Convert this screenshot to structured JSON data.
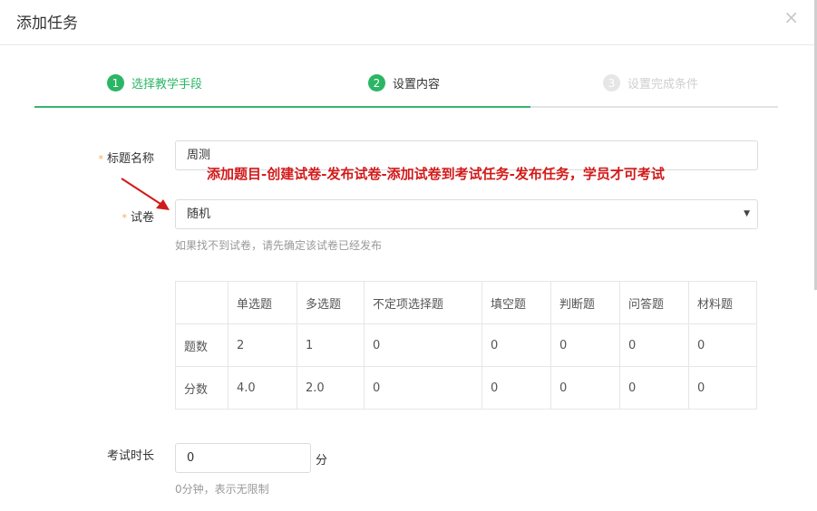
{
  "modal": {
    "title": "添加任务",
    "close": "×"
  },
  "steps": [
    {
      "num": "1",
      "label": "选择教学手段"
    },
    {
      "num": "2",
      "label": "设置内容"
    },
    {
      "num": "3",
      "label": "设置完成条件"
    }
  ],
  "form": {
    "title_label": "标题名称",
    "title_value": "周测",
    "paper_label": "试卷",
    "paper_value": "随机",
    "paper_hint": "如果找不到试卷，请先确定该试卷已经发布",
    "duration_label": "考试时长",
    "duration_value": "0",
    "duration_unit": "分",
    "duration_hint": "0分钟，表示无限制",
    "required_mark": "*"
  },
  "annotation": {
    "text": "添加题目-创建试卷-发布试卷-添加试卷到考试任务-发布任务，学员才可考试"
  },
  "question_table": {
    "headers": [
      "",
      "单选题",
      "多选题",
      "不定项选择题",
      "填空题",
      "判断题",
      "问答题",
      "材料题"
    ],
    "rows": [
      [
        "题数",
        "2",
        "1",
        "0",
        "0",
        "0",
        "0",
        "0"
      ],
      [
        "分数",
        "4.0",
        "2.0",
        "0",
        "0",
        "0",
        "0",
        "0"
      ]
    ]
  },
  "colors": {
    "accent": "#2bb666",
    "annotation": "#d21a1a",
    "required": "#f0ad4e"
  }
}
